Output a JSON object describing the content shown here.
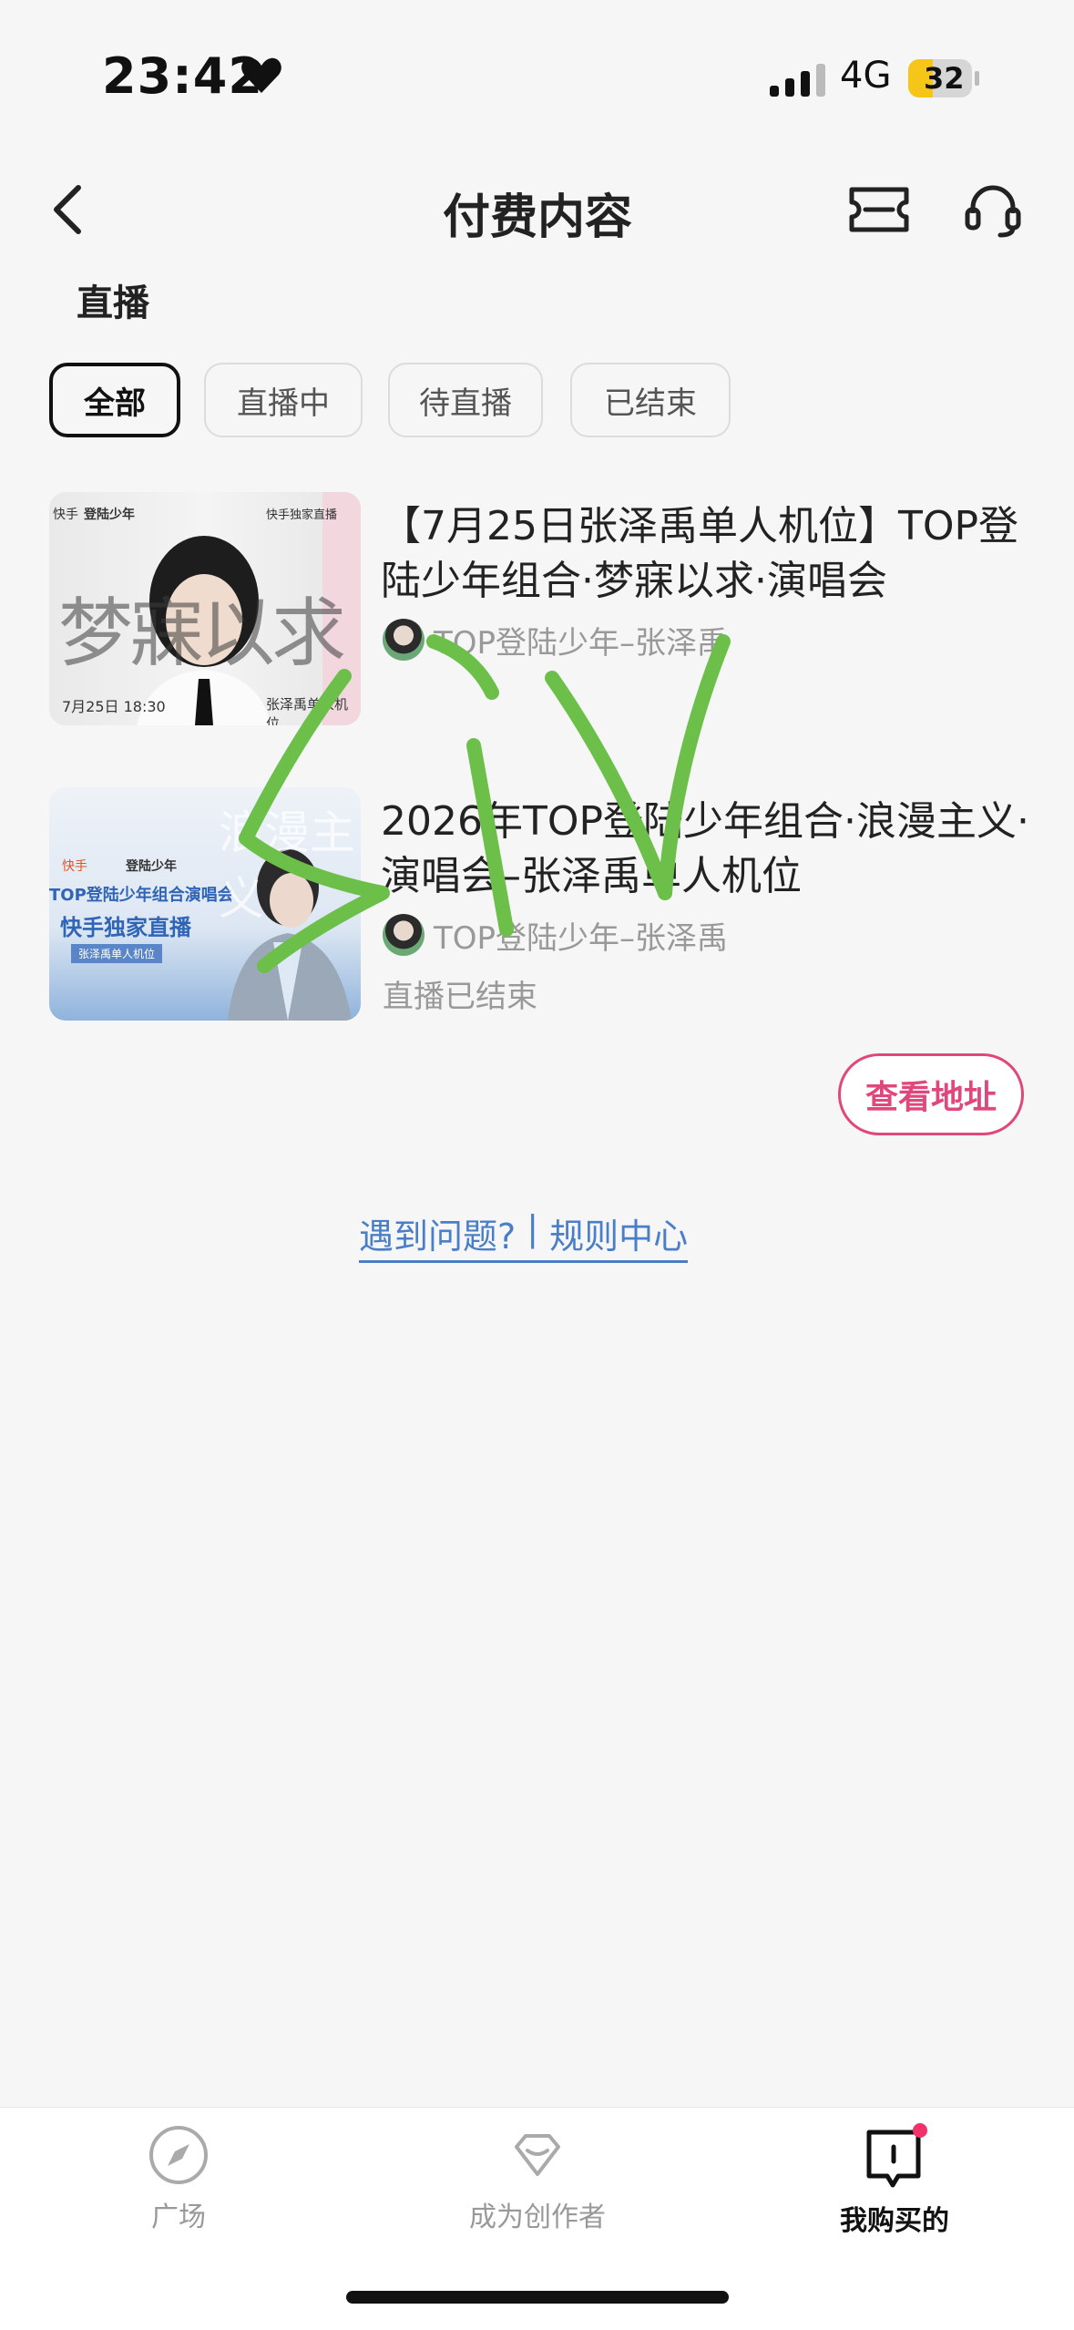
{
  "status_bar": {
    "time": "23:42",
    "network": "4G",
    "battery": "32"
  },
  "nav": {
    "title": "付费内容"
  },
  "section": {
    "title": "直播"
  },
  "tabs": [
    {
      "label": "全部",
      "active": true
    },
    {
      "label": "直播中",
      "active": false
    },
    {
      "label": "待直播",
      "active": false
    },
    {
      "label": "已结束",
      "active": false
    }
  ],
  "items": [
    {
      "title": "【7月25日张泽禹单人机位】TOP登陆少年组合·梦寐以求·演唱会",
      "author": "TOP登陆少年–张泽禹",
      "thumb": {
        "brand": "快手",
        "group": "登陆少年",
        "tag": "快手独家直播",
        "big_text": "梦寐以求",
        "date": "7月25日 18:30",
        "name": "张泽禹单人机位"
      }
    },
    {
      "title": "2026年TOP登陆少年组合·浪漫主义·演唱会–张泽禹单人机位",
      "author": "TOP登陆少年–张泽禹",
      "status": "直播已结束",
      "thumb": {
        "brand": "快手",
        "group": "登陆少年",
        "line1": "TOP登陆少年组合演唱会",
        "line2": "快手独家直播",
        "line3": "张泽禹单人机位",
        "big_text": "浪漫主义"
      }
    }
  ],
  "actions": {
    "view_address": "查看地址"
  },
  "help": {
    "question": "遇到问题?",
    "separator": " | ",
    "rules": "规则中心"
  },
  "bottom_tabs": [
    {
      "label": "广场",
      "icon": "compass-icon",
      "active": false
    },
    {
      "label": "成为创作者",
      "icon": "creator-icon",
      "active": false
    },
    {
      "label": "我购买的",
      "icon": "purchased-icon",
      "active": true,
      "badge": true
    }
  ],
  "colors": {
    "accent": "#e0477a",
    "link": "#4a7fc8",
    "scribble": "#6cc04a",
    "background": "#f6f6f6"
  }
}
